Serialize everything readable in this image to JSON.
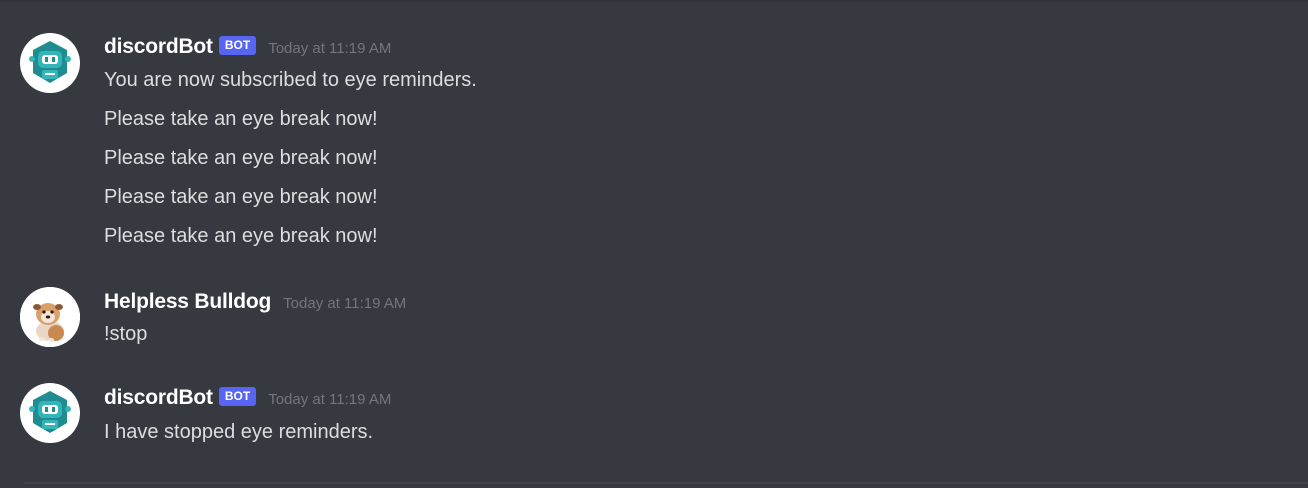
{
  "messages": [
    {
      "author": "discordBot",
      "bot_tag": "BOT",
      "timestamp": "Today at 11:19 AM",
      "avatar_icon": "robot-icon",
      "lines": [
        "You are now subscribed to eye reminders.",
        "Please take an eye break now!",
        "Please take an eye break now!",
        "Please take an eye break now!",
        "Please take an eye break now!"
      ]
    },
    {
      "author": "Helpless Bulldog",
      "timestamp": "Today at 11:19 AM",
      "avatar_icon": "bulldog-avatar",
      "lines": [
        "!stop"
      ]
    },
    {
      "author": "discordBot",
      "bot_tag": "BOT",
      "timestamp": "Today at 11:19 AM",
      "avatar_icon": "robot-icon",
      "lines": [
        "I have stopped eye reminders."
      ]
    }
  ],
  "colors": {
    "background": "#36393f",
    "bot_tag": "#5865f2",
    "robot_teal": "#34b5b9",
    "username": "#ffffff",
    "message_text": "#dcddde",
    "timestamp": "#72767d"
  }
}
